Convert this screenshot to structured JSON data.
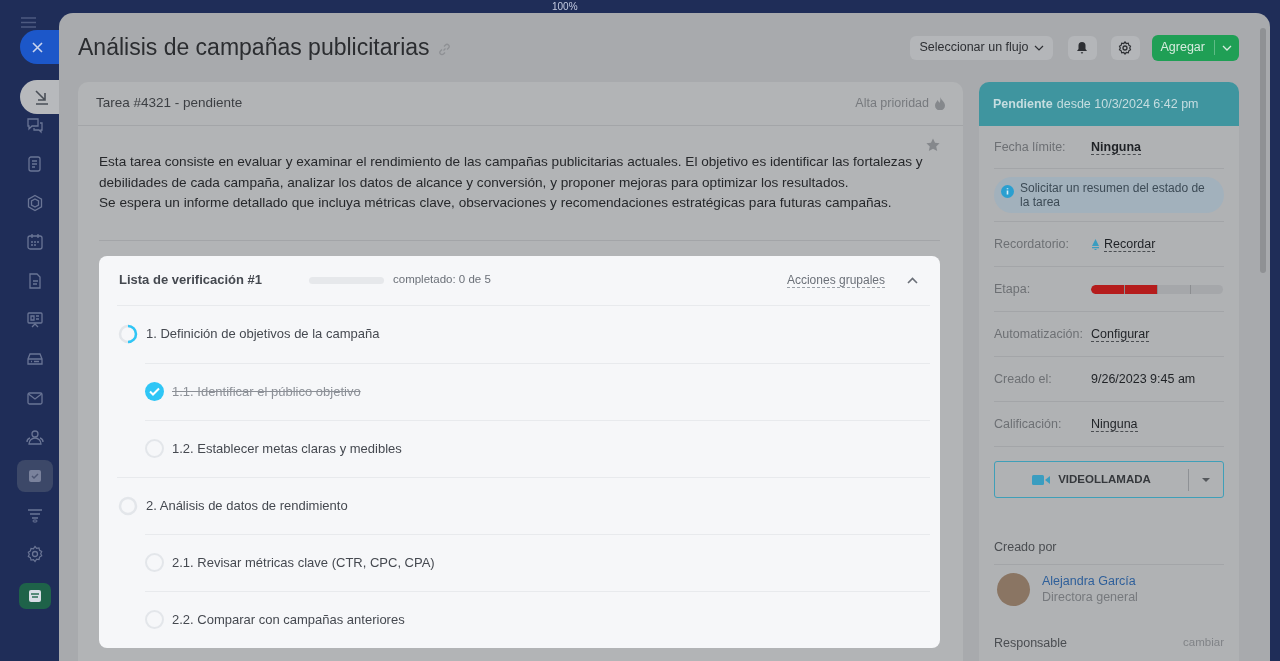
{
  "zoom_label": "100%",
  "sidebar": {
    "items": [
      {
        "selected": false
      },
      {
        "selected": false
      },
      {
        "selected": false
      },
      {
        "selected": false
      },
      {
        "selected": false
      },
      {
        "selected": false
      },
      {
        "selected": false
      },
      {
        "selected": false
      },
      {
        "selected": false
      },
      {
        "selected": true
      },
      {
        "selected": false
      },
      {
        "selected": false
      },
      {
        "selected": false
      }
    ]
  },
  "window": {
    "title": "Análisis de campañas publicitarias"
  },
  "toolbar": {
    "flow_select": "Seleccionar un flujo",
    "add_button": "Agregar"
  },
  "task": {
    "header": "Tarea #4321 - pendiente",
    "priority": "Alta prioridad",
    "starred": false,
    "description": [
      "Esta tarea consiste en evaluar y examinar el rendimiento de las campañas publicitarias actuales. El objetivo es identificar las fortalezas y debilidades de cada campaña, analizar los datos de alcance y conversión, y proponer mejoras para optimizar los resultados.",
      "Se espera un informe detallado que incluya métricas clave, observaciones y recomendaciones estratégicas para futuras campañas."
    ]
  },
  "checklist": {
    "title": "Lista de verificación #1",
    "level": 0,
    "progress": "completado: 0 de 5",
    "group_actions": "Acciones grupales",
    "expanded": true,
    "items": [
      {
        "label": "1. Definición de objetivos de la campaña",
        "started": true,
        "children": [
          {
            "label": "1.1. Identificar el público objetivo",
            "checked": true
          },
          {
            "label": "1.2. Establecer metas claras y medibles",
            "checked": false
          }
        ]
      },
      {
        "label": "2. Análisis de datos de rendimiento",
        "started": false,
        "children": [
          {
            "label": "2.1. Revisar métricas clave (CTR, CPC, CPA)",
            "checked": false
          },
          {
            "label": "2.2. Comparar con campañas anteriores",
            "checked": false
          }
        ]
      }
    ]
  },
  "status": {
    "state": "Pendiente",
    "since": "desde 10/3/2024 6:42 pm"
  },
  "fields": [
    {
      "kind": "link",
      "label": "Fecha límite:",
      "value": "Ninguna"
    },
    {
      "kind": "info",
      "value": "Solicitar un resumen del estado de la tarea"
    },
    {
      "kind": "reminder",
      "label": "Recordatorio:",
      "value": "Recordar"
    },
    {
      "kind": "stage",
      "label": "Etapa:",
      "level": 0.5
    },
    {
      "kind": "link",
      "label": "Automatización:",
      "value": "Configurar"
    },
    {
      "kind": "text",
      "label": "Creado el:",
      "value": "9/26/2023 9:45 am"
    },
    {
      "kind": "link",
      "label": "Calificación:",
      "value": "Ninguna"
    }
  ],
  "video_call": "VIDEOLLAMADA",
  "created_by": {
    "label": "Creado por",
    "name": "Alejandra García",
    "role": "Directora general"
  },
  "responsible": {
    "label": "Responsable",
    "action": "cambiar"
  }
}
